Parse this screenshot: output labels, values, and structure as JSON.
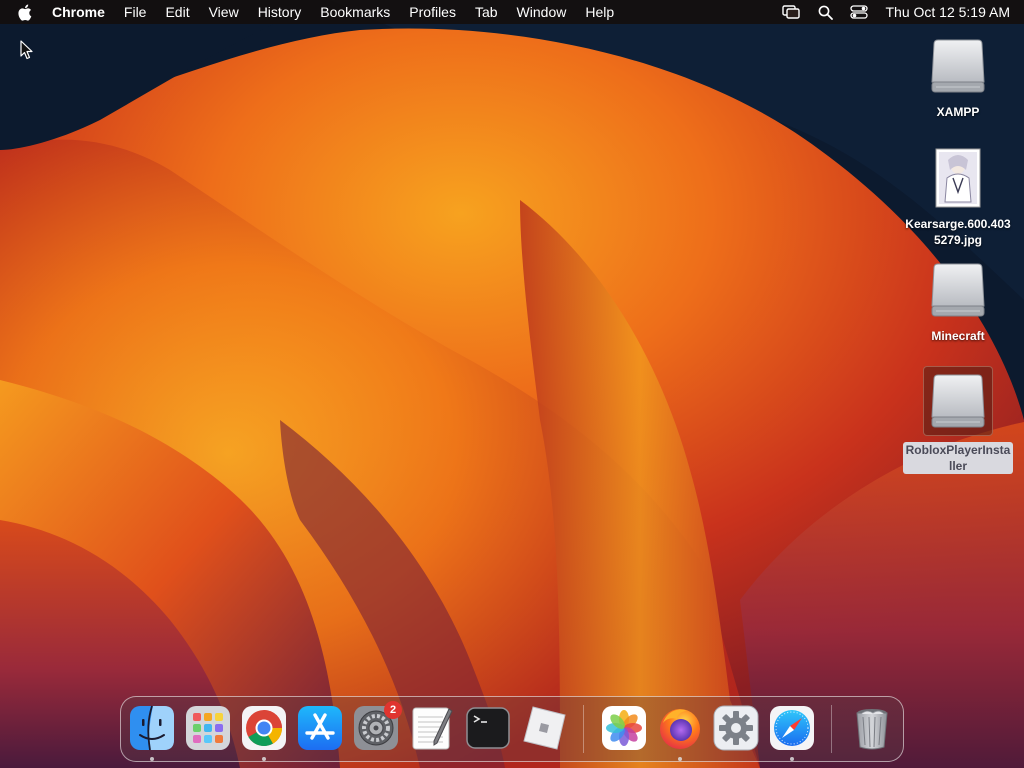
{
  "menubar": {
    "app_name": "Chrome",
    "items": [
      "File",
      "Edit",
      "View",
      "History",
      "Bookmarks",
      "Profiles",
      "Tab",
      "Window",
      "Help"
    ],
    "clock": "Thu Oct 12  5:19 AM",
    "status_icons": [
      "screen-mirroring-icon",
      "spotlight-search-icon",
      "control-center-icon"
    ]
  },
  "desktop": {
    "icons": [
      {
        "label": "XAMPP",
        "kind": "disk-image",
        "selected": false
      },
      {
        "label": "Kearsarge.600.4035279.jpg",
        "kind": "image-file",
        "selected": false
      },
      {
        "label": "Minecraft",
        "kind": "disk-image",
        "selected": false
      },
      {
        "label": "RobloxPlayerInstaller",
        "kind": "disk-image",
        "selected": true
      }
    ]
  },
  "dock": {
    "apps": [
      {
        "name": "Finder",
        "icon": "finder-icon",
        "running": true
      },
      {
        "name": "Launchpad",
        "icon": "launchpad-icon",
        "running": false
      },
      {
        "name": "Google Chrome",
        "icon": "chrome-icon",
        "running": true
      },
      {
        "name": "App Store",
        "icon": "app-store-icon",
        "running": false
      },
      {
        "name": "System Preferences",
        "icon": "system-preferences-icon",
        "running": false,
        "badge": "2"
      },
      {
        "name": "TextEdit",
        "icon": "textedit-icon",
        "running": false
      },
      {
        "name": "Terminal",
        "icon": "terminal-icon",
        "running": false
      },
      {
        "name": "Roblox",
        "icon": "roblox-icon",
        "running": false
      },
      {
        "name": "Photos",
        "icon": "photos-icon",
        "running": false
      },
      {
        "name": "Firefox",
        "icon": "firefox-icon",
        "running": true
      },
      {
        "name": "System Settings",
        "icon": "gear-icon",
        "running": false
      },
      {
        "name": "Safari",
        "icon": "safari-icon",
        "running": true
      },
      {
        "name": "Trash",
        "icon": "trash-icon",
        "running": false
      }
    ]
  },
  "colors": {
    "wallpaper_dark": "#0c1a2e",
    "wallpaper_orange": "#f08a1c",
    "wallpaper_red": "#c8321c",
    "badge_red": "#e0342f"
  }
}
